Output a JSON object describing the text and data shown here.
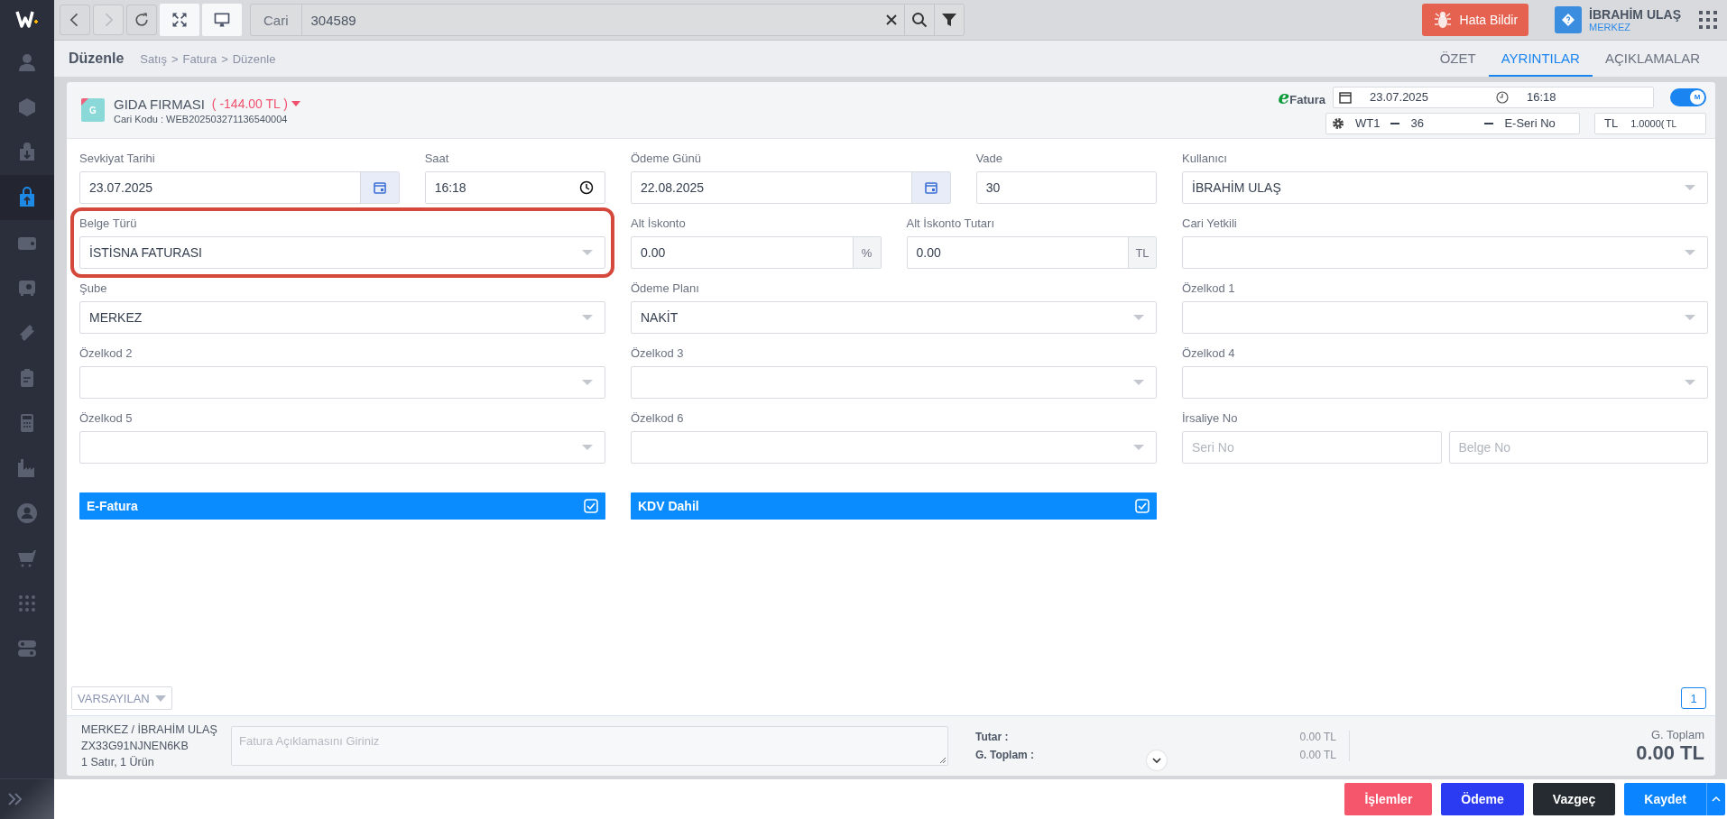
{
  "sidebar": {
    "items": [
      {
        "selected": false
      },
      {
        "selected": false
      },
      {
        "selected": false
      },
      {
        "selected": true
      },
      {
        "selected": false
      },
      {
        "selected": false
      },
      {
        "selected": false
      },
      {
        "selected": false
      },
      {
        "selected": false
      },
      {
        "selected": false
      },
      {
        "selected": false
      },
      {
        "selected": false
      },
      {
        "selected": false
      },
      {
        "selected": false
      }
    ]
  },
  "toolbar": {
    "buttons": [
      {
        "kind": "back",
        "active": false,
        "disabled": false
      },
      {
        "kind": "forward",
        "active": false,
        "disabled": true
      },
      {
        "kind": "refresh",
        "active": false,
        "disabled": false
      },
      {
        "kind": "fullscreen",
        "active": true,
        "disabled": false
      },
      {
        "kind": "monitor",
        "active": true,
        "disabled": false
      }
    ],
    "search": {
      "label": "Cari",
      "value": "304589"
    },
    "report_button": "Hata Bildir",
    "user": {
      "name": "İBRAHİM ULAŞ",
      "branch": "MERKEZ"
    }
  },
  "breadcrumb": {
    "title": "Düzenle",
    "path": [
      "Satış",
      "Fatura",
      "Düzenle"
    ],
    "separator": ">"
  },
  "tabs": [
    {
      "label": "ÖZET",
      "selected": false
    },
    {
      "label": "AYRINTILAR",
      "selected": true
    },
    {
      "label": "AÇIKLAMALAR",
      "selected": false
    }
  ],
  "customer": {
    "initial": "G",
    "name": "GIDA FIRMASI",
    "balance": "( -144.00 TL )",
    "code": "Cari Kodu : WEB202503271136540004"
  },
  "document": {
    "logo_mark": "e",
    "logo_text": "Fatura",
    "date": "23.07.2025",
    "time": "16:18",
    "toggle": {
      "label": "M",
      "on": true
    },
    "series": "WT1",
    "number": "36",
    "e_series": "E-Seri No",
    "currency": "TL",
    "rate": "1.0000(",
    "rate_unit": "TL"
  },
  "form": {
    "rows": [
      {
        "columns": [
          {
            "fields": [
              {
                "kind": "date",
                "label": "Sevkiyat Tarihi",
                "value": "23.07.2025"
              },
              {
                "kind": "time",
                "label": "Saat",
                "value": "16:18"
              }
            ]
          },
          {
            "fields": [
              {
                "kind": "date",
                "label": "Ödeme Günü",
                "value": "22.08.2025"
              },
              {
                "kind": "text",
                "label": "Vade",
                "value": "30"
              }
            ]
          },
          {
            "fields": [
              {
                "kind": "select",
                "label": "Kullanıcı",
                "value": "İBRAHİM ULAŞ"
              }
            ]
          }
        ]
      },
      {
        "columns": [
          {
            "fields": [
              {
                "kind": "select",
                "label": "Belge Türü",
                "value": "İSTİSNA FATURASI",
                "highlighted": true
              }
            ]
          },
          {
            "fields": [
              {
                "kind": "suffix",
                "label": "Alt İskonto",
                "value": "0.00",
                "suffix": "%"
              },
              {
                "kind": "suffix",
                "label": "Alt İskonto Tutarı",
                "value": "0.00",
                "suffix": "TL"
              }
            ]
          },
          {
            "fields": [
              {
                "kind": "select",
                "label": "Cari Yetkili"
              }
            ]
          }
        ]
      },
      {
        "columns": [
          {
            "fields": [
              {
                "kind": "select",
                "label": "Şube",
                "value": "MERKEZ"
              }
            ]
          },
          {
            "fields": [
              {
                "kind": "select",
                "label": "Ödeme Planı",
                "value": "NAKİT"
              }
            ]
          },
          {
            "fields": [
              {
                "kind": "select",
                "label": "Özelkod 1"
              }
            ]
          }
        ]
      },
      {
        "columns": [
          {
            "fields": [
              {
                "kind": "select",
                "label": "Özelkod 2"
              }
            ]
          },
          {
            "fields": [
              {
                "kind": "select",
                "label": "Özelkod 3"
              }
            ]
          },
          {
            "fields": [
              {
                "kind": "select",
                "label": "Özelkod 4"
              }
            ]
          }
        ]
      },
      {
        "columns": [
          {
            "fields": [
              {
                "kind": "select",
                "label": "Özelkod 5"
              }
            ]
          },
          {
            "fields": [
              {
                "kind": "select",
                "label": "Özelkod 6"
              }
            ]
          },
          {
            "fields": [
              {
                "kind": "pair",
                "label": "İrsaliye No",
                "placeholders": [
                  "Seri No",
                  "Belge No"
                ]
              }
            ]
          }
        ]
      }
    ],
    "checks": [
      {
        "label": "E-Fatura",
        "checked": true
      },
      {
        "label": "KDV Dahil",
        "checked": true
      }
    ]
  },
  "template_select": "VARSAYILAN",
  "pager": [
    {
      "label": "1",
      "selected": true
    }
  ],
  "summary": {
    "info": [
      "MERKEZ / İBRAHİM ULAŞ",
      "ZX33G91NJNEN6KB",
      "1 Satır, 1 Ürün"
    ],
    "note_placeholder": "Fatura Açıklamasını Giriniz",
    "totals": [
      {
        "label": "Tutar :",
        "value": "0.00 TL"
      },
      {
        "label": "G. Toplam :",
        "value": "0.00 TL"
      }
    ],
    "grand_label": "G. Toplam",
    "grand_value": "0.00 TL"
  },
  "actions": [
    {
      "kind": "danger",
      "label": "İşlemler"
    },
    {
      "kind": "payment",
      "label": "Ödeme"
    },
    {
      "kind": "cancel",
      "label": "Vazgeç"
    },
    {
      "kind": "save",
      "label": "Kaydet"
    }
  ]
}
